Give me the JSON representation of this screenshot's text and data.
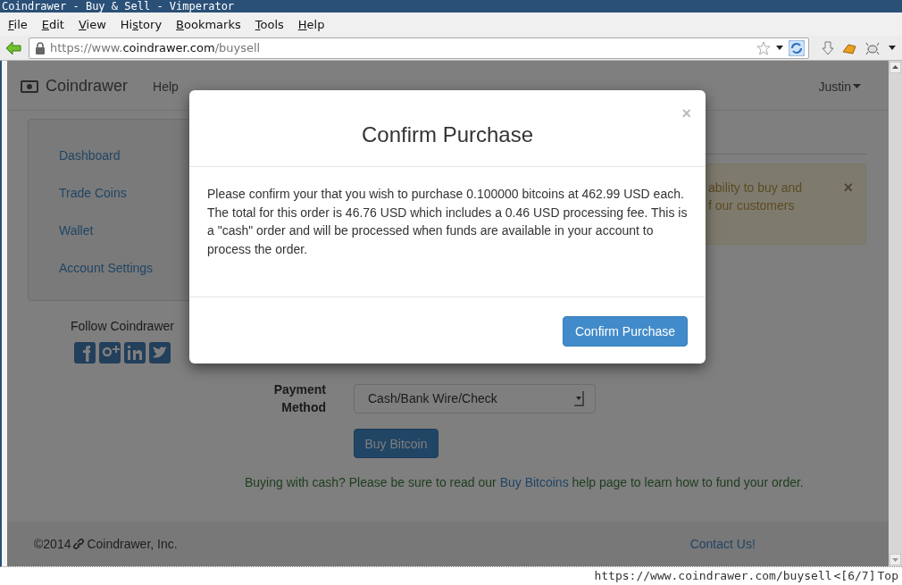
{
  "window": {
    "title": "Coindrawer - Buy & Sell - Vimperator"
  },
  "menu": [
    {
      "key": "F",
      "post": "ile"
    },
    {
      "key": "E",
      "post": "dit"
    },
    {
      "key": "V",
      "post": "iew"
    },
    {
      "pre": "Hi",
      "key": "s",
      "post": "tory"
    },
    {
      "key": "B",
      "post": "ookmarks"
    },
    {
      "key": "T",
      "post": "ools"
    },
    {
      "key": "H",
      "post": "elp"
    }
  ],
  "address_bar": {
    "scheme": "https://www.",
    "domain": "coindrawer.com",
    "path": "/buysell"
  },
  "navbar": {
    "brand": "Coindrawer",
    "links": [
      "Help"
    ],
    "user": "Justin"
  },
  "sidebar": {
    "items": [
      "Dashboard",
      "Trade Coins",
      "Wallet",
      "Account Settings"
    ]
  },
  "follow": {
    "heading": "Follow Coindrawer"
  },
  "alert": {
    "lines": [
      "ability to buy and",
      "f our customers"
    ],
    "close": "×"
  },
  "form": {
    "label": "Payment Method",
    "select_value": "Cash/Bank Wire/Check",
    "button": "Buy Bitcoin",
    "note_before": "Buying with cash? Please be sure to read our ",
    "note_link": "Buy Bitcoins",
    "note_after": " help page to learn how to fund your order."
  },
  "footer": {
    "copyright": "©2014",
    "company": "Coindrawer, Inc.",
    "contact": "Contact Us!"
  },
  "modal": {
    "title": "Confirm Purchase",
    "close": "×",
    "body": "Please confirm your that you wish to purchase 0.100000 bitcoins at 462.99 USD each. The total for this order is 46.76 USD which includes a 0.46 USD processing fee. This is a \"cash\" order and will be processed when funds are available in your account to process the order.",
    "button": "Confirm Purchase"
  },
  "status_bar": {
    "url": "https://www.coindrawer.com/buysell",
    "position": "<[6/7]",
    "scroll": "Top"
  }
}
